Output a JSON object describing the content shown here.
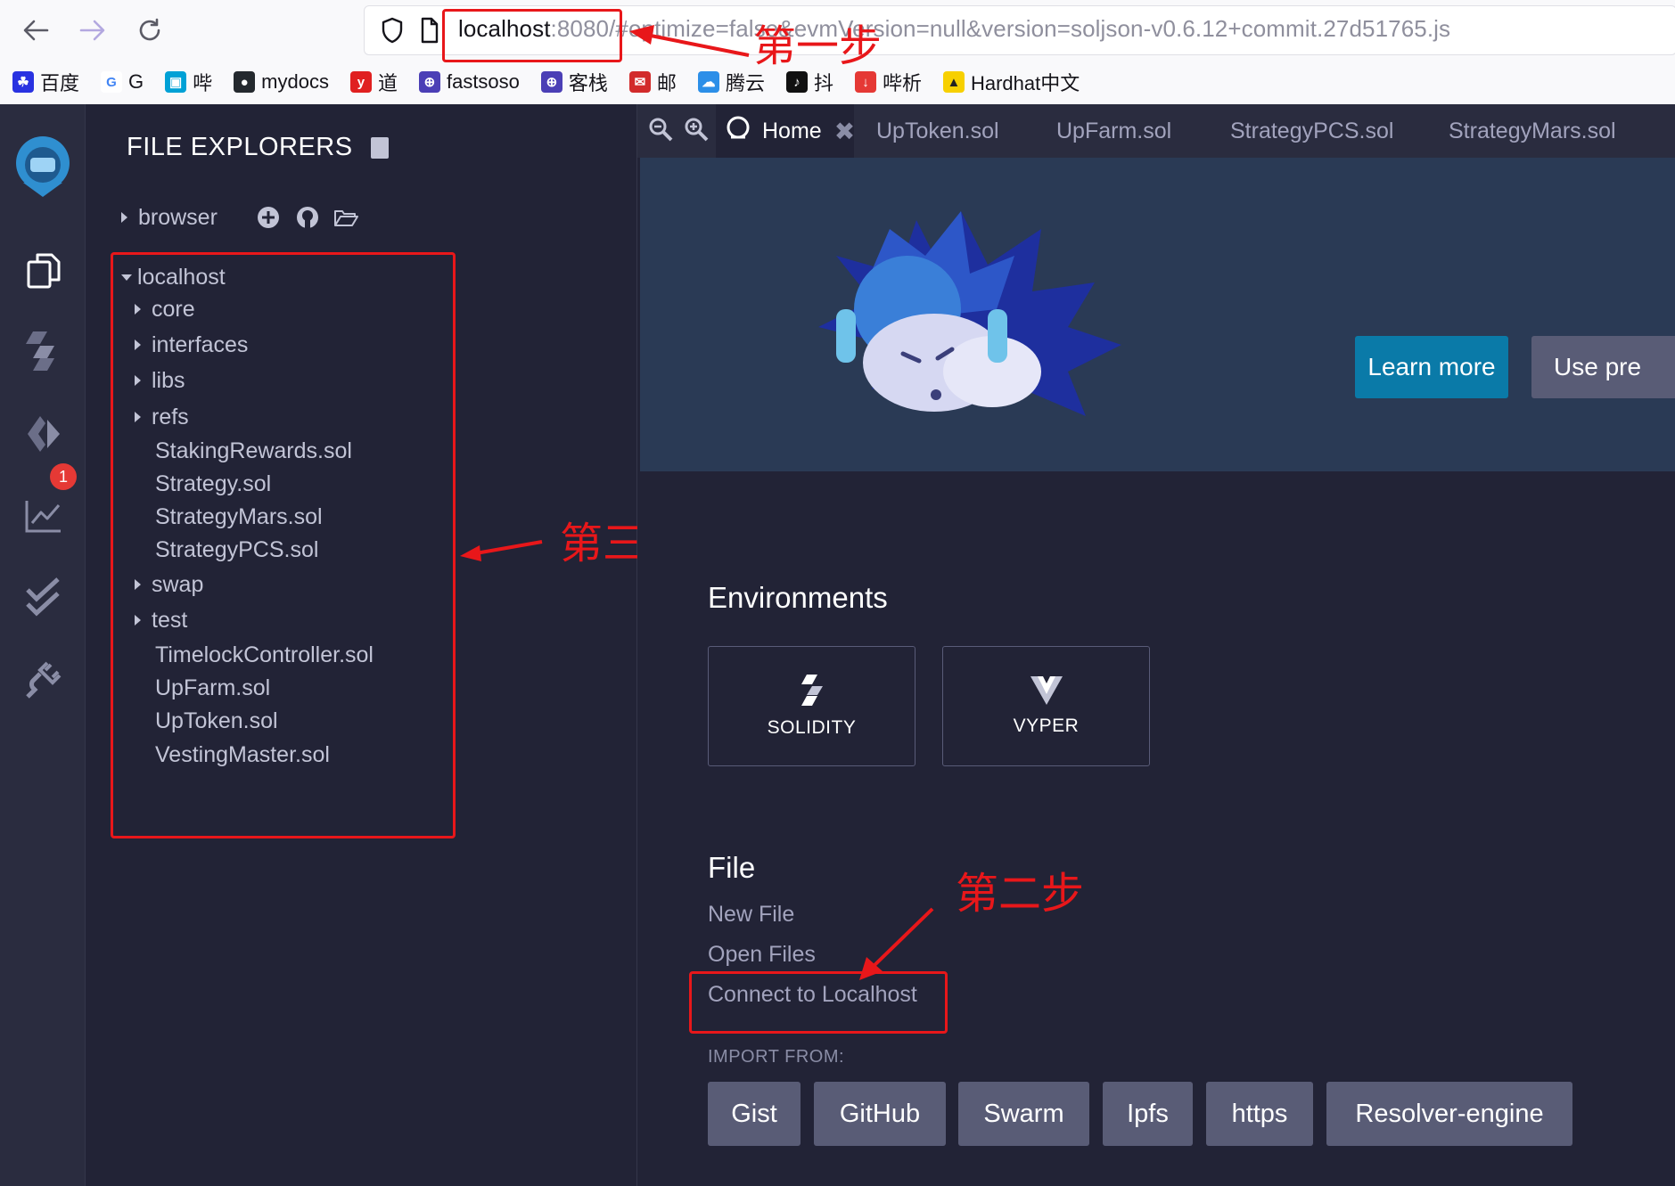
{
  "browser": {
    "url_host": "localhost",
    "url_rest": ":8080/#optimize=false&evmVersion=null&version=soljson-v0.6.12+commit.27d51765.js",
    "bookmarks": [
      {
        "label": "百度",
        "icon": "baidu-icon",
        "color": "#2932e1",
        "glyph": "☘"
      },
      {
        "label": "G",
        "icon": "google-icon",
        "color": "#ffffff",
        "glyph": "G"
      },
      {
        "label": "哔",
        "icon": "bilibili-icon",
        "color": "#00a1d6",
        "glyph": "▣"
      },
      {
        "label": "mydocs",
        "icon": "github-icon",
        "color": "#24292e",
        "glyph": "●"
      },
      {
        "label": "道",
        "icon": "youdao-icon",
        "color": "#e02020",
        "glyph": "y"
      },
      {
        "label": "fastsoso",
        "icon": "globe-icon",
        "color": "#4b3fb6",
        "glyph": "⊕"
      },
      {
        "label": "客栈",
        "icon": "globe-icon",
        "color": "#4b3fb6",
        "glyph": "⊕"
      },
      {
        "label": "邮",
        "icon": "mail-163-icon",
        "color": "#d22b2b",
        "glyph": "✉"
      },
      {
        "label": "腾云",
        "icon": "tencent-cloud-icon",
        "color": "#2c8fe8",
        "glyph": "☁"
      },
      {
        "label": "抖",
        "icon": "tiktok-icon",
        "color": "#111111",
        "glyph": "♪"
      },
      {
        "label": "哔析",
        "icon": "download-icon",
        "color": "#e53935",
        "glyph": "↓"
      },
      {
        "label": "Hardhat中文",
        "icon": "hardhat-icon",
        "color": "#f7d000",
        "glyph": "▲"
      }
    ]
  },
  "explorer": {
    "title": "FILE EXPLORERS",
    "browser_label": "browser",
    "localhost_label": "localhost",
    "items": [
      {
        "label": "core",
        "folder": true
      },
      {
        "label": "interfaces",
        "folder": true
      },
      {
        "label": "libs",
        "folder": true
      },
      {
        "label": "refs",
        "folder": true
      },
      {
        "label": "StakingRewards.sol",
        "folder": false
      },
      {
        "label": "Strategy.sol",
        "folder": false
      },
      {
        "label": "StrategyMars.sol",
        "folder": false
      },
      {
        "label": "StrategyPCS.sol",
        "folder": false
      },
      {
        "label": "swap",
        "folder": true
      },
      {
        "label": "test",
        "folder": true
      },
      {
        "label": "TimelockController.sol",
        "folder": false
      },
      {
        "label": "UpFarm.sol",
        "folder": false
      },
      {
        "label": "UpToken.sol",
        "folder": false
      },
      {
        "label": "VestingMaster.sol",
        "folder": false
      }
    ]
  },
  "iconbar": {
    "compiler_badge": "1"
  },
  "tabs": {
    "home": "Home",
    "files": [
      "UpToken.sol",
      "UpFarm.sol",
      "StrategyPCS.sol",
      "StrategyMars.sol"
    ]
  },
  "home": {
    "learn_more": "Learn more",
    "use_previous": "Use pre",
    "environments_title": "Environments",
    "env_solidity": "SOLIDITY",
    "env_vyper": "VYPER",
    "file_title": "File",
    "new_file": "New File",
    "open_files": "Open Files",
    "connect_localhost": "Connect to Localhost",
    "import_from": "IMPORT FROM:",
    "import_buttons": [
      "Gist",
      "GitHub",
      "Swarm",
      "Ipfs",
      "https",
      "Resolver-engine"
    ]
  },
  "annotations": {
    "step1": "第一步",
    "step2": "第二步",
    "step3": "第三步",
    "color": "#e8171a"
  }
}
